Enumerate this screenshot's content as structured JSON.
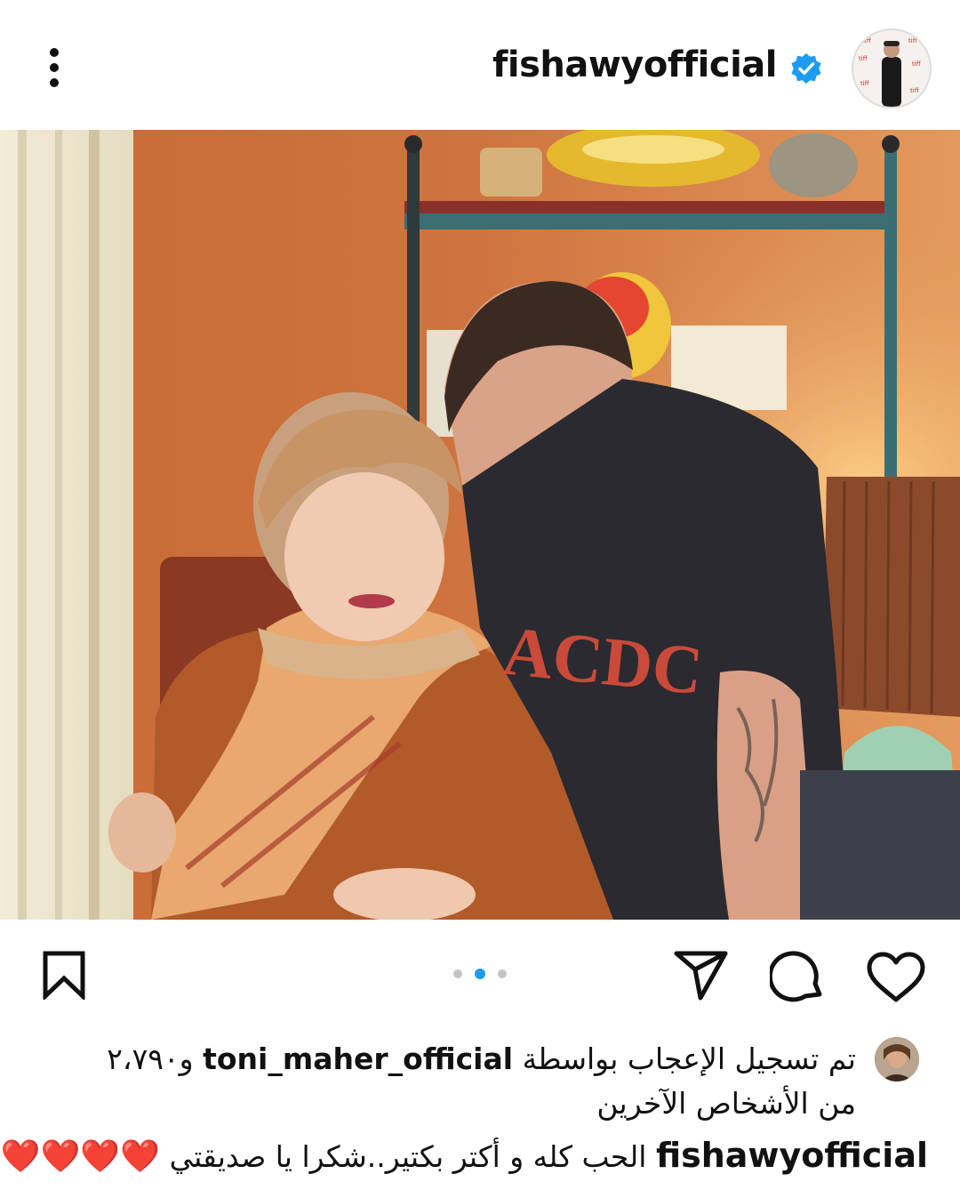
{
  "post": {
    "username": "fishawyofficial",
    "verified": true,
    "menu_icon": "more-vertical-icon",
    "carousel": {
      "current": 2,
      "total": 3
    }
  },
  "likes": {
    "prefix": "تم تسجيل الإعجاب بواسطة",
    "liker": "toni_maher_official",
    "suffix": "و٢،٧٩٠ من الأشخاص الآخرين"
  },
  "caption": {
    "username": "fishawyofficial",
    "text": "الحب كله و أكتر بكتير..شكرا يا صديقتي",
    "emoji": "❤️❤️❤️❤️"
  },
  "colors": {
    "accent": "#1d9bf0",
    "heart": "#e0245e",
    "verified": "#1d9bf0"
  },
  "icons": [
    "heart-icon",
    "comment-icon",
    "share-icon",
    "bookmark-icon",
    "verified-badge-icon"
  ]
}
